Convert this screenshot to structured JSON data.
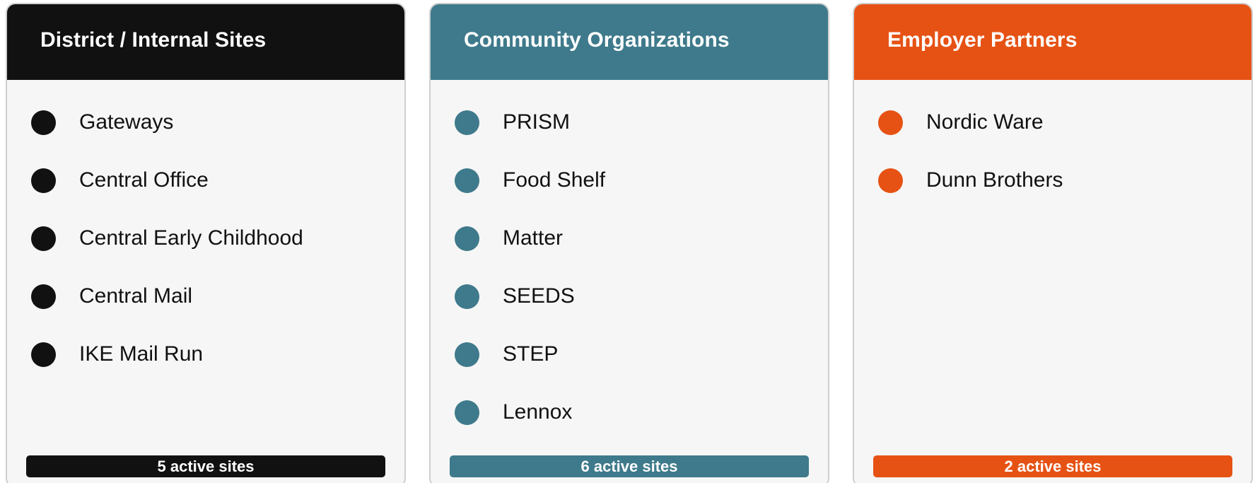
{
  "columns": [
    {
      "title": "District / Internal Sites",
      "color": "#111111",
      "items": [
        "Gateways",
        "Central Office",
        "Central Early Childhood",
        "Central Mail",
        "IKE Mail Run"
      ],
      "footer": "5 active sites"
    },
    {
      "title": "Community Organizations",
      "color": "#3e7a8b",
      "items": [
        "PRISM",
        "Food Shelf",
        "Matter",
        "SEEDS",
        "STEP",
        "Lennox"
      ],
      "footer": "6 active sites"
    },
    {
      "title": "Employer Partners",
      "color": "#e65214",
      "items": [
        "Nordic Ware",
        "Dunn Brothers"
      ],
      "footer": "2 active sites"
    }
  ]
}
